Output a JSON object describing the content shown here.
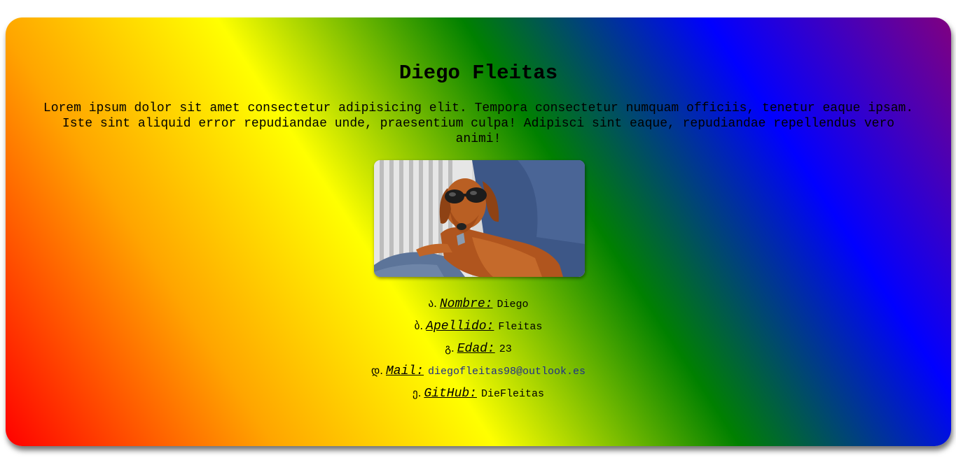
{
  "profile": {
    "name": "Diego Fleitas",
    "description": "Lorem ipsum dolor sit amet consectetur adipisicing elit. Tempora consectetur numquam officiis, tenetur eaque ipsam. Iste sint aliquid error repudiandae unde, praesentium culpa! Adipisci sint eaque, repudiandae repellendus vero animi!",
    "photo_icon": "dachshund-with-sunglasses-photo"
  },
  "info": [
    {
      "marker": "ა.",
      "label": "Nombre:",
      "value": "Diego"
    },
    {
      "marker": "ბ.",
      "label": "Apellido:",
      "value": "Fleitas"
    },
    {
      "marker": "გ.",
      "label": "Edad:",
      "value": "23"
    },
    {
      "marker": "დ.",
      "label": "Mail:",
      "value": "diegofleitas98@outlook.es"
    },
    {
      "marker": "ე.",
      "label": "GitHub:",
      "value": "DieFleitas"
    }
  ],
  "colors": {
    "gradient": [
      "#ff0000",
      "#ffa500",
      "#ffff00",
      "#008000",
      "#0000ff",
      "#800080"
    ],
    "link": "#1f2d8a"
  }
}
